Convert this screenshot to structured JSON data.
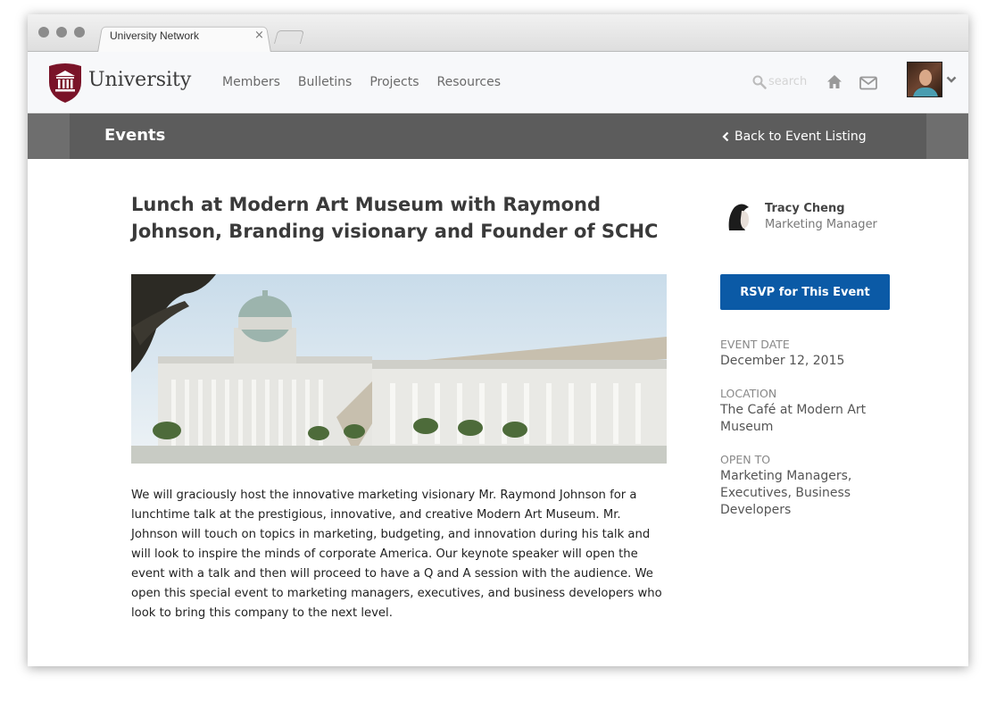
{
  "browser": {
    "tab_title": "University Network",
    "tab_close": "×"
  },
  "header": {
    "logo_text": "University",
    "nav": [
      "Members",
      "Bulletins",
      "Projects",
      "Resources"
    ],
    "search_placeholder": "search",
    "icons": [
      "search-icon",
      "home-icon",
      "mail-icon",
      "chevron-down-icon"
    ]
  },
  "events_bar": {
    "title": "Events",
    "back_label": "Back to Event Listing"
  },
  "event": {
    "title": "Lunch at Modern Art Museum with Raymond Johnson, Branding visionary and Founder of SCHC",
    "description": "We will graciously host the innovative marketing visionary Mr. Raymond Johnson for a lunchtime talk at the prestigious, innovative, and creative Modern Art Museum.  Mr. Johnson will touch on topics in marketing, budgeting, and innovation during his talk and will look to inspire the minds of corporate America. Our keynote speaker will open the event with a talk and then will proceed to have a Q and A session with the audience. We open this special event to marketing managers, executives, and business developers who look to bring this company to the next level."
  },
  "host": {
    "name": "Tracy Cheng",
    "role": "Marketing Manager"
  },
  "sidebar": {
    "rsvp_label": "RSVP for This Event",
    "date_label": "EVENT DATE",
    "date_value": "December 12, 2015",
    "location_label": "LOCATION",
    "location_value": "The Café at Modern Art Museum",
    "open_label": "OPEN TO",
    "open_value": "Marketing Managers, Executives, Business Developers"
  },
  "colors": {
    "brand": "#7a1328",
    "rsvp": "#0b5aa6",
    "events_bar": "#5c5c5c"
  }
}
